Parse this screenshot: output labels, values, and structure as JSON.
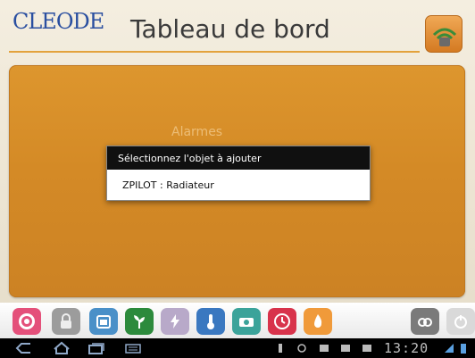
{
  "header": {
    "logo": "CLEODE",
    "title": "Tableau de bord"
  },
  "board": {
    "faint_text": "Alarmes"
  },
  "dialog": {
    "title": "Sélectionnez l'objet à ajouter",
    "items": [
      {
        "label": "ZPILOT : Radiateur"
      }
    ]
  },
  "icon_bar": {
    "icons": [
      {
        "name": "target-icon",
        "color": "#e4507a"
      },
      {
        "name": "lock-icon",
        "color": "#9c9c9c"
      },
      {
        "name": "battery-icon",
        "color": "#4a90c8"
      },
      {
        "name": "plant-icon",
        "color": "#2c8a3c"
      },
      {
        "name": "lightning-icon",
        "color": "#b8a9c9"
      },
      {
        "name": "thermometer-icon",
        "color": "#3a78c0"
      },
      {
        "name": "camera-icon",
        "color": "#3ba39a"
      },
      {
        "name": "alarm-icon",
        "color": "#d8334b"
      },
      {
        "name": "fire-icon",
        "color": "#f09a3a"
      },
      {
        "name": "link-icon",
        "color": "#7a7a7a"
      },
      {
        "name": "power-icon",
        "color": "#cfcfcf"
      }
    ]
  },
  "status_bar": {
    "time": "13:20"
  },
  "colors": {
    "accent": "#e3a23c",
    "board": "#d48a26",
    "logo": "#2a4fa0"
  }
}
